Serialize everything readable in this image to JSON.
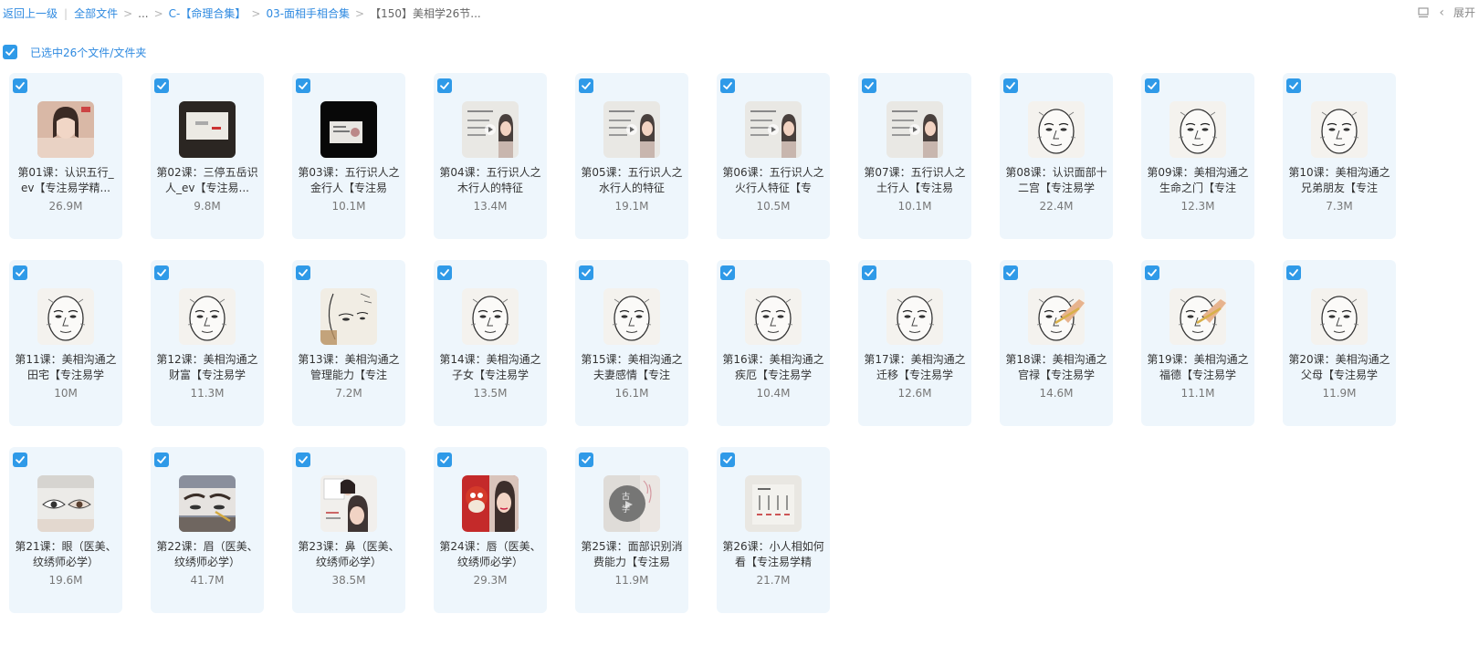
{
  "breadcrumb": {
    "back": "返回上一级",
    "all_files": "全部文件",
    "ellipsis": "...",
    "level1": "C-【命理合集】",
    "level2": "03-面相手相合集",
    "current": "【150】美相学26节..."
  },
  "toolbar": {
    "expand_label": "展开"
  },
  "selection": {
    "text": "已选中26个文件/文件夹"
  },
  "accent_color": "#2f9ae8",
  "files": [
    {
      "name": "第01课：认识五行_ev【专注易学精...",
      "size": "26.9M",
      "thumb": "person"
    },
    {
      "name": "第02课：三停五岳识人_ev【专注易...",
      "size": "9.8M",
      "thumb": "dark-board"
    },
    {
      "name": "第03课：五行识人之金行人【专注易",
      "size": "10.1M",
      "thumb": "black"
    },
    {
      "name": "第04课：五行识人之木行人的特征",
      "size": "13.4M",
      "thumb": "board-person"
    },
    {
      "name": "第05课：五行识人之水行人的特征",
      "size": "19.1M",
      "thumb": "board-person"
    },
    {
      "name": "第06课：五行识人之火行人特征【专",
      "size": "10.5M",
      "thumb": "board-person"
    },
    {
      "name": "第07课：五行识人之土行人【专注易",
      "size": "10.1M",
      "thumb": "board-person"
    },
    {
      "name": "第08课：认识面部十二宫【专注易学",
      "size": "22.4M",
      "thumb": "face"
    },
    {
      "name": "第09课：美相沟通之生命之门【专注",
      "size": "12.3M",
      "thumb": "face"
    },
    {
      "name": "第10课：美相沟通之兄弟朋友【专注",
      "size": "7.3M",
      "thumb": "face"
    },
    {
      "name": "第11课：美相沟通之田宅【专注易学",
      "size": "10M",
      "thumb": "face"
    },
    {
      "name": "第12课：美相沟通之财富【专注易学",
      "size": "11.3M",
      "thumb": "face"
    },
    {
      "name": "第13课：美相沟通之管理能力【专注",
      "size": "7.2M",
      "thumb": "face-side"
    },
    {
      "name": "第14课：美相沟通之子女【专注易学",
      "size": "13.5M",
      "thumb": "face"
    },
    {
      "name": "第15课：美相沟通之夫妻感情【专注",
      "size": "16.1M",
      "thumb": "face"
    },
    {
      "name": "第16课：美相沟通之疾厄【专注易学",
      "size": "10.4M",
      "thumb": "face"
    },
    {
      "name": "第17课：美相沟通之迁移【专注易学",
      "size": "12.6M",
      "thumb": "face"
    },
    {
      "name": "第18课：美相沟通之官禄【专注易学",
      "size": "14.6M",
      "thumb": "face-hand"
    },
    {
      "name": "第19课：美相沟通之福德【专注易学",
      "size": "11.1M",
      "thumb": "face-hand"
    },
    {
      "name": "第20课：美相沟通之父母【专注易学",
      "size": "11.9M",
      "thumb": "face"
    },
    {
      "name": "第21课：眼（医美、纹绣师必学）",
      "size": "19.6M",
      "thumb": "eye"
    },
    {
      "name": "第22课：眉（医美、纹绣师必学）",
      "size": "41.7M",
      "thumb": "brow"
    },
    {
      "name": "第23课：鼻（医美、纹绣师必学）",
      "size": "38.5M",
      "thumb": "nose"
    },
    {
      "name": "第24课：唇（医美、纹绣师必学）",
      "size": "29.3M",
      "thumb": "lips"
    },
    {
      "name": "第25课：面部识别消费能力【专注易",
      "size": "11.9M",
      "thumb": "gray-play"
    },
    {
      "name": "第26课：小人相如何看【专注易学精",
      "size": "21.7M",
      "thumb": "paper"
    }
  ]
}
